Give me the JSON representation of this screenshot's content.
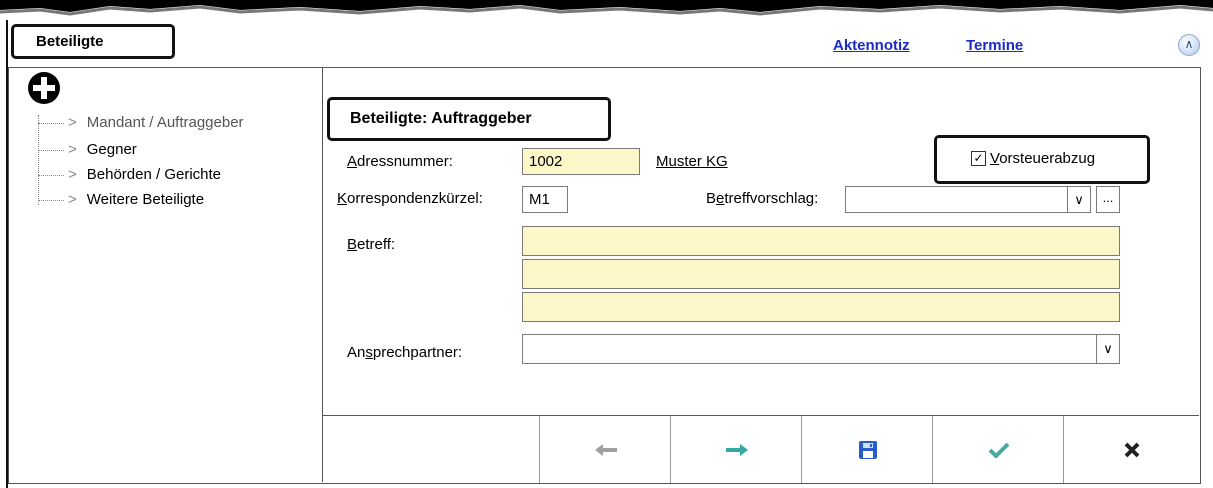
{
  "header": {
    "tab_label": "Beteiligte",
    "links": [
      "Aktennotiz",
      "Termine"
    ],
    "collapse_icon": "double-chevron-up-icon"
  },
  "tree": {
    "add_icon": "plus-circle-icon",
    "items": [
      {
        "label": "Mandant / Auftraggeber",
        "selected": true
      },
      {
        "label": "Gegner",
        "selected": false
      },
      {
        "label": "Behörden / Gerichte",
        "selected": false
      },
      {
        "label": "Weitere Beteiligte",
        "selected": false
      }
    ]
  },
  "form": {
    "section_title": "Beteiligte: Auftraggeber",
    "adressnummer_label": "Adressnummer:",
    "adressnummer_value": "1002",
    "adress_name": "Muster KG",
    "vorsteuer_label": "Vorsteuerabzug",
    "vorsteuer_checked": true,
    "korrespondenz_label": "Korrespondenzkürzel:",
    "korrespondenz_value": "M1",
    "betreffvorschlag_label": "Betreffvorschlag:",
    "betreffvorschlag_value": "",
    "betreff_label": "Betreff:",
    "betreff_lines": [
      "",
      "",
      ""
    ],
    "ansprechpartner_label": "Ansprechpartner:",
    "ansprechpartner_value": ""
  },
  "toolbar": {
    "buttons": [
      "back-arrow-icon",
      "forward-arrow-icon",
      "save-disk-icon",
      "confirm-check-icon",
      "cancel-x-icon"
    ]
  },
  "colors": {
    "link": "#1a2cc8",
    "field_yellow": "#fdf6c9",
    "arrow_back": "#a0a0a0",
    "arrow_forward": "#35a9a0",
    "check": "#4aa9a0",
    "save": "#2a5bc8"
  }
}
